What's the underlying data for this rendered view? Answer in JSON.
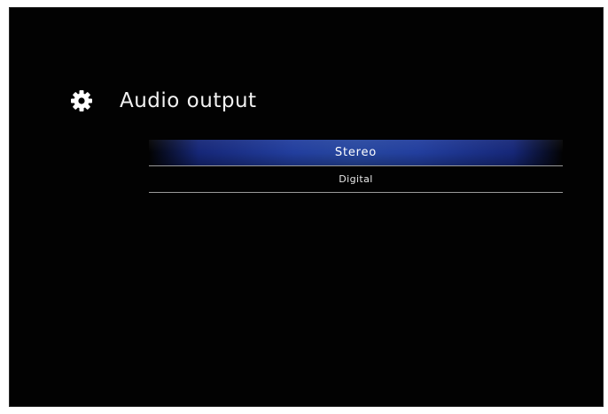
{
  "header": {
    "icon": "gear-icon",
    "title": "Audio output"
  },
  "menu": {
    "items": [
      {
        "label": "Stereo",
        "selected": true
      },
      {
        "label": "Digital",
        "selected": false
      }
    ]
  },
  "colors": {
    "background": "#020202",
    "selection": "#27479f",
    "text": "#f2f2f2",
    "divider": "#9a9a9a"
  }
}
